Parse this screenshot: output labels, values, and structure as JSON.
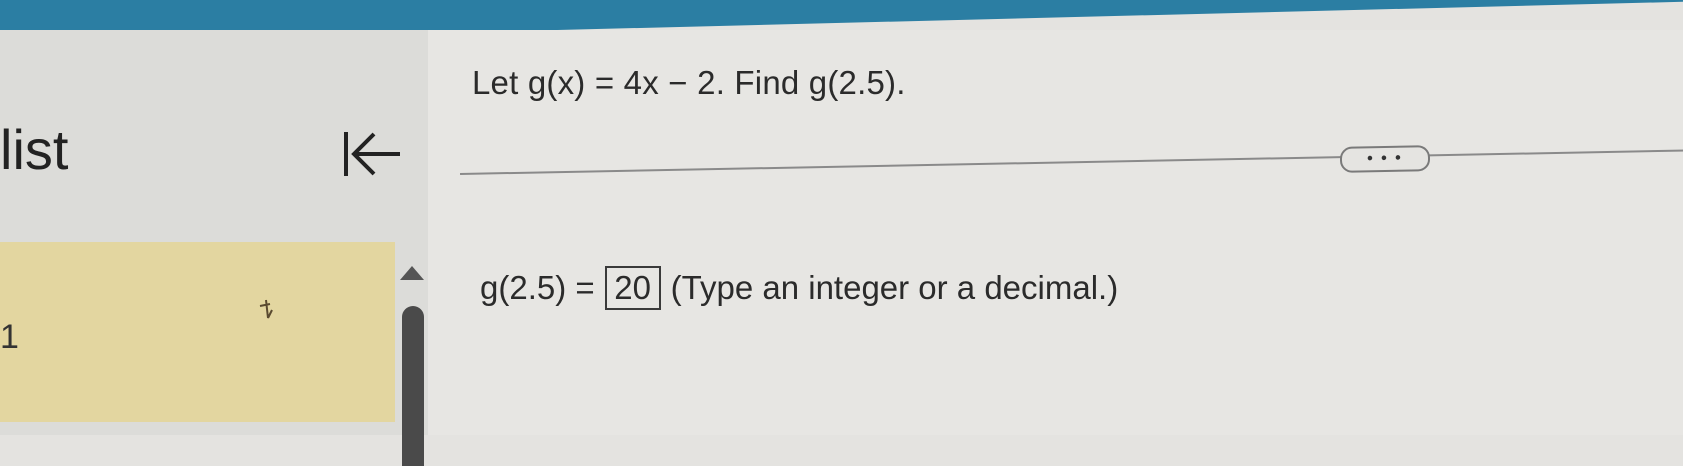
{
  "sidebar": {
    "title": "list",
    "question_number": "1"
  },
  "problem": {
    "statement": "Let g(x) = 4x − 2. Find g(2.5)."
  },
  "more_button": {
    "label": "• • •"
  },
  "answer": {
    "prefix": "g(2.5) =",
    "value": "20",
    "hint": "(Type an integer or a decimal.)"
  },
  "colors": {
    "top_bar": "#2b7ea3",
    "question_highlight": "#e3d6a0",
    "background": "#e7e6e3"
  },
  "icons": {
    "collapse": "collapse-left-icon",
    "scroll_up": "triangle-up-icon"
  }
}
